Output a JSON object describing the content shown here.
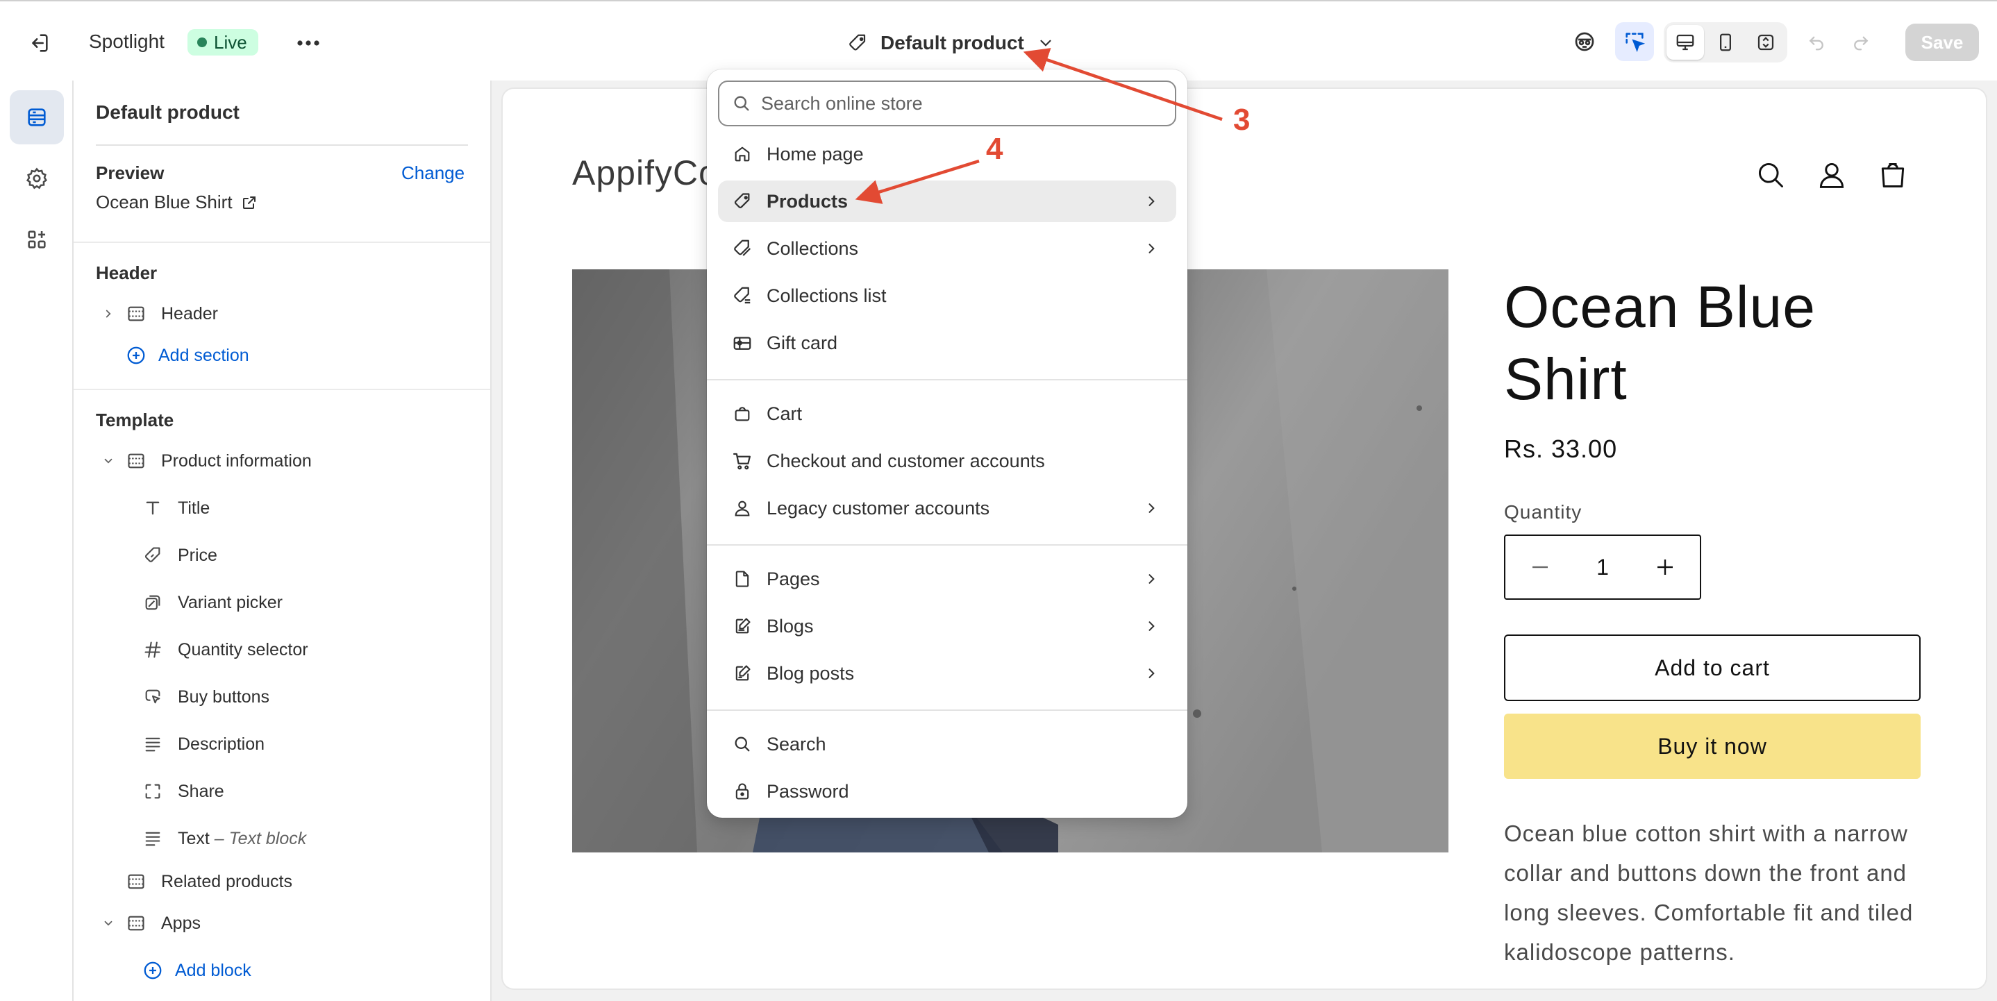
{
  "topbar": {
    "theme_name": "Spotlight",
    "status": "Live",
    "template_selector": "Default product",
    "save_label": "Save"
  },
  "sidebar": {
    "title": "Default product",
    "preview": {
      "heading": "Preview",
      "change_label": "Change",
      "value": "Ocean Blue Shirt"
    },
    "header_group": {
      "heading": "Header",
      "items": [
        "Header"
      ],
      "add_section": "Add section"
    },
    "template_group": {
      "heading": "Template",
      "section": "Product information",
      "blocks": [
        {
          "label": "Title",
          "icon": "text-icon"
        },
        {
          "label": "Price",
          "icon": "price-tag-icon"
        },
        {
          "label": "Variant picker",
          "icon": "variant-icon"
        },
        {
          "label": "Quantity selector",
          "icon": "hash-icon"
        },
        {
          "label": "Buy buttons",
          "icon": "cursor-click-icon"
        },
        {
          "label": "Description",
          "icon": "align-left-icon"
        },
        {
          "label": "Share",
          "icon": "share-frame-icon"
        },
        {
          "label": "Text",
          "suffix": "Text block",
          "icon": "align-left-icon"
        }
      ],
      "related": "Related products",
      "apps": "Apps",
      "add_block": "Add block"
    }
  },
  "dropdown": {
    "search_placeholder": "Search online store",
    "groups": [
      [
        {
          "label": "Home page",
          "icon": "home-icon",
          "has_submenu": false
        },
        {
          "label": "Products",
          "icon": "tag-icon",
          "has_submenu": true,
          "active": true
        },
        {
          "label": "Collections",
          "icon": "collections-icon",
          "has_submenu": true
        },
        {
          "label": "Collections list",
          "icon": "collections-list-icon",
          "has_submenu": false
        },
        {
          "label": "Gift card",
          "icon": "gift-card-icon",
          "has_submenu": false
        }
      ],
      [
        {
          "label": "Cart",
          "icon": "bag-icon",
          "has_submenu": false
        },
        {
          "label": "Checkout and customer accounts",
          "icon": "cart-icon",
          "has_submenu": false
        },
        {
          "label": "Legacy customer accounts",
          "icon": "person-icon",
          "has_submenu": true
        }
      ],
      [
        {
          "label": "Pages",
          "icon": "page-icon",
          "has_submenu": true
        },
        {
          "label": "Blogs",
          "icon": "blog-icon",
          "has_submenu": true
        },
        {
          "label": "Blog posts",
          "icon": "blog-post-icon",
          "has_submenu": true
        }
      ],
      [
        {
          "label": "Search",
          "icon": "search-icon",
          "has_submenu": false
        },
        {
          "label": "Password",
          "icon": "lock-icon",
          "has_submenu": false
        }
      ]
    ]
  },
  "store": {
    "logo": "AppifyCo",
    "product_title": "Ocean Blue Shirt",
    "price": "Rs. 33.00",
    "quantity_label": "Quantity",
    "quantity_value": "1",
    "add_to_cart": "Add to cart",
    "buy_now": "Buy it now",
    "description": "Ocean blue cotton shirt with a narrow collar and buttons down the front and long sleeves. Comfortable fit and tiled kalidoscope patterns."
  },
  "annotations": {
    "step_a": "3",
    "step_b": "4"
  },
  "colors": {
    "accent": "#005bd3",
    "live_bg": "#cdfee1",
    "buy_button": "#f8e38a",
    "annotation": "#e24a33"
  }
}
